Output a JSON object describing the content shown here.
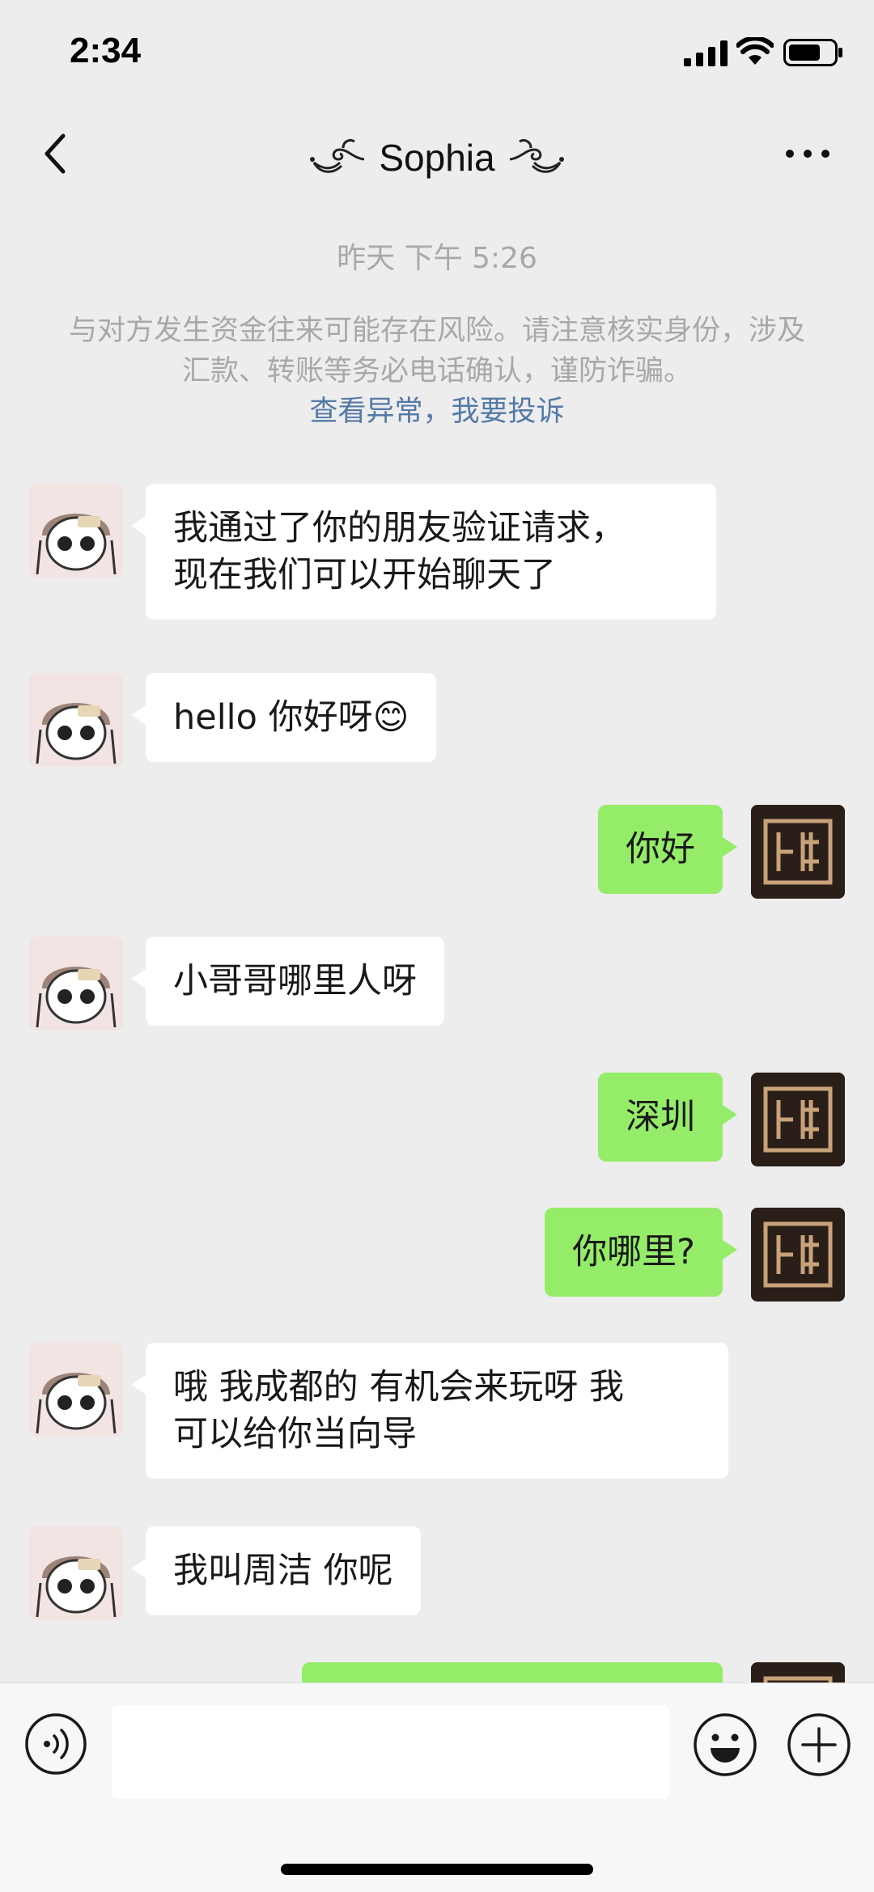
{
  "status_bar": {
    "time": "2:34",
    "icons": [
      "signal-icon",
      "wifi-icon",
      "battery-icon"
    ]
  },
  "nav": {
    "back_icon": "chevron-left-icon",
    "title": "Sophia",
    "more_icon": "more-dots-icon"
  },
  "chat": {
    "timestamp": "昨天 下午 5:26",
    "warning": {
      "text": "与对方发生资金往来可能存在风险。请注意核实身份，涉及汇款、转账等务必电话确认，谨防诈骗。",
      "link_view": "查看异常",
      "separator": "，",
      "link_report": "我要投诉"
    },
    "messages": [
      {
        "from": "them",
        "line1": "我通过了你的朋友验证请求，",
        "line2": "现在我们可以开始聊天了"
      },
      {
        "from": "them",
        "text": "hello 你好呀",
        "emoji": "😊"
      },
      {
        "from": "me",
        "text": "你好"
      },
      {
        "from": "them",
        "text": "小哥哥哪里人呀"
      },
      {
        "from": "me",
        "text": "深圳"
      },
      {
        "from": "me",
        "text": "你哪里?"
      },
      {
        "from": "them",
        "line1": "哦 我成都的  有机会来玩呀 我",
        "line2": "可以给你当向导"
      },
      {
        "from": "them",
        "text": "我叫周洁 你呢"
      },
      {
        "from": "me",
        "text": ""
      }
    ]
  },
  "input_bar": {
    "voice_icon": "voice-icon",
    "input_value": "",
    "emoji_icon": "emoji-icon",
    "plus_icon": "plus-icon"
  },
  "colors": {
    "background": "#ededed",
    "incoming_bubble": "#ffffff",
    "outgoing_bubble": "#95ec69",
    "link": "#5479a6",
    "muted_text": "#a8a8a8"
  }
}
